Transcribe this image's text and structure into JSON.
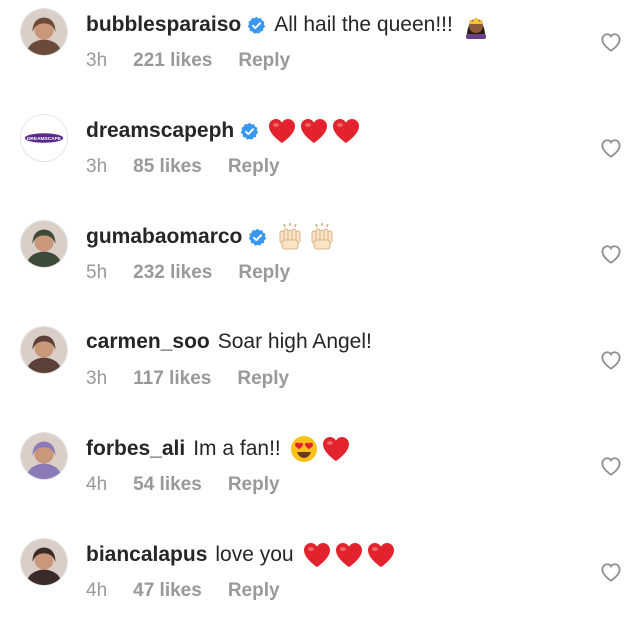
{
  "comments": [
    {
      "username": "bubblesparaiso",
      "verified": true,
      "text": "All hail the queen!!!",
      "emojis": [
        "woman-crown-emoji"
      ],
      "time": "3h",
      "likes": "221 likes",
      "reply": "Reply",
      "avatar_color": "#6b4a3a"
    },
    {
      "username": "dreamscapeph",
      "verified": true,
      "text": "",
      "emojis": [
        "red-heart-emoji",
        "red-heart-emoji",
        "red-heart-emoji"
      ],
      "time": "3h",
      "likes": "85 likes",
      "reply": "Reply",
      "avatar_logo_text": "DREAMSCAPE",
      "avatar_color": "#ffffff"
    },
    {
      "username": "gumabaomarco",
      "verified": true,
      "text": "",
      "emojis": [
        "raising-hands-emoji",
        "raising-hands-emoji"
      ],
      "time": "5h",
      "likes": "232 likes",
      "reply": "Reply",
      "avatar_color": "#3d4a3a"
    },
    {
      "username": "carmen_soo",
      "verified": false,
      "text": "Soar high Angel!",
      "emojis": [],
      "time": "3h",
      "likes": "117 likes",
      "reply": "Reply",
      "avatar_color": "#5a4038"
    },
    {
      "username": "forbes_ali",
      "verified": false,
      "text": "Im a fan!!",
      "emojis": [
        "heart-eyes-emoji",
        "red-heart-emoji"
      ],
      "time": "4h",
      "likes": "54 likes",
      "reply": "Reply",
      "avatar_color": "#8a7ab8"
    },
    {
      "username": "biancalapus",
      "verified": false,
      "text": "love you",
      "emojis": [
        "red-heart-emoji",
        "red-heart-emoji",
        "red-heart-emoji"
      ],
      "time": "4h",
      "likes": "47 likes",
      "reply": "Reply",
      "avatar_color": "#3a2a28"
    }
  ],
  "colors": {
    "verified_blue": "#3897f0",
    "heart_red": "#ed4956",
    "meta_gray": "#999999",
    "text": "#262626"
  }
}
